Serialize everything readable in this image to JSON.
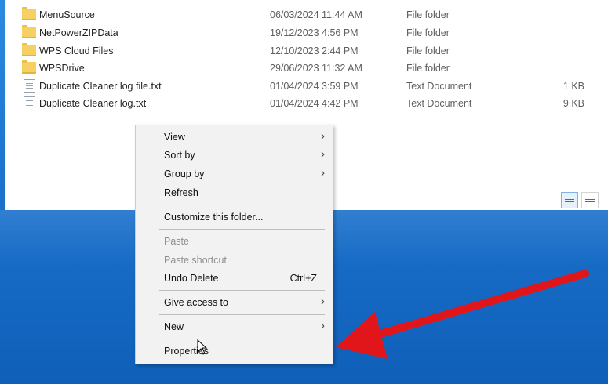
{
  "files": [
    {
      "name": "MenuSource",
      "date": "06/03/2024 11:44 AM",
      "type": "File folder",
      "size": "",
      "icon": "folder-icon"
    },
    {
      "name": "NetPowerZIPData",
      "date": "19/12/2023 4:56 PM",
      "type": "File folder",
      "size": "",
      "icon": "folder-icon"
    },
    {
      "name": "WPS Cloud Files",
      "date": "12/10/2023 2:44 PM",
      "type": "File folder",
      "size": "",
      "icon": "folder-icon"
    },
    {
      "name": "WPSDrive",
      "date": "29/06/2023 11:32 AM",
      "type": "File folder",
      "size": "",
      "icon": "folder-icon"
    },
    {
      "name": "Duplicate Cleaner log file.txt",
      "date": "01/04/2024 3:59 PM",
      "type": "Text Document",
      "size": "1 KB",
      "icon": "text-document-icon"
    },
    {
      "name": "Duplicate Cleaner log.txt",
      "date": "01/04/2024 4:42 PM",
      "type": "Text Document",
      "size": "9 KB",
      "icon": "text-document-icon"
    }
  ],
  "context_menu": {
    "view": "View",
    "sort_by": "Sort by",
    "group_by": "Group by",
    "refresh": "Refresh",
    "customize": "Customize this folder...",
    "paste": "Paste",
    "paste_shortcut": "Paste shortcut",
    "undo_delete": "Undo Delete",
    "undo_delete_shortcut": "Ctrl+Z",
    "give_access": "Give access to",
    "new": "New",
    "properties": "Properties",
    "submenu_glyph": "›"
  },
  "colors": {
    "annotation_arrow": "#e0161b",
    "desktop": "#1c74cf"
  }
}
